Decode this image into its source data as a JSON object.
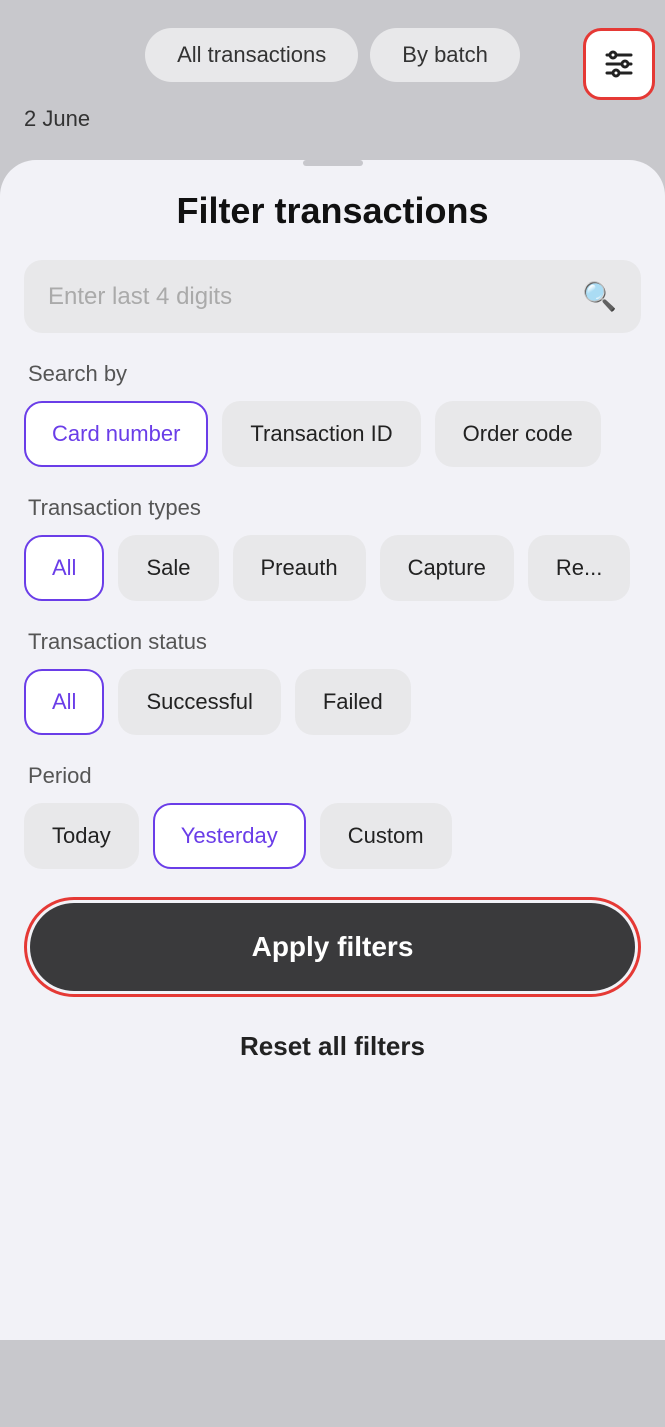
{
  "topNav": {
    "tabs": [
      {
        "label": "All transactions",
        "active": true
      },
      {
        "label": "By batch",
        "active": false
      }
    ],
    "filterButton": "filter-icon"
  },
  "dateLabel": "2 June",
  "sheet": {
    "title": "Filter transactions",
    "search": {
      "placeholder": "Enter last 4 digits"
    },
    "searchByLabel": "Search by",
    "searchByChips": [
      {
        "label": "Card number",
        "selected": true
      },
      {
        "label": "Transaction ID",
        "selected": false
      },
      {
        "label": "Order code",
        "selected": false
      }
    ],
    "transactionTypesLabel": "Transaction types",
    "transactionTypeChips": [
      {
        "label": "All",
        "selected": true
      },
      {
        "label": "Sale",
        "selected": false
      },
      {
        "label": "Preauth",
        "selected": false
      },
      {
        "label": "Capture",
        "selected": false
      },
      {
        "label": "Re...",
        "selected": false
      }
    ],
    "transactionStatusLabel": "Transaction status",
    "transactionStatusChips": [
      {
        "label": "All",
        "selected": true
      },
      {
        "label": "Successful",
        "selected": false
      },
      {
        "label": "Failed",
        "selected": false
      }
    ],
    "periodLabel": "Period",
    "periodChips": [
      {
        "label": "Today",
        "selected": false
      },
      {
        "label": "Yesterday",
        "selected": true
      },
      {
        "label": "Custom",
        "selected": false
      }
    ],
    "applyButton": "Apply filters",
    "resetButton": "Reset all filters"
  }
}
